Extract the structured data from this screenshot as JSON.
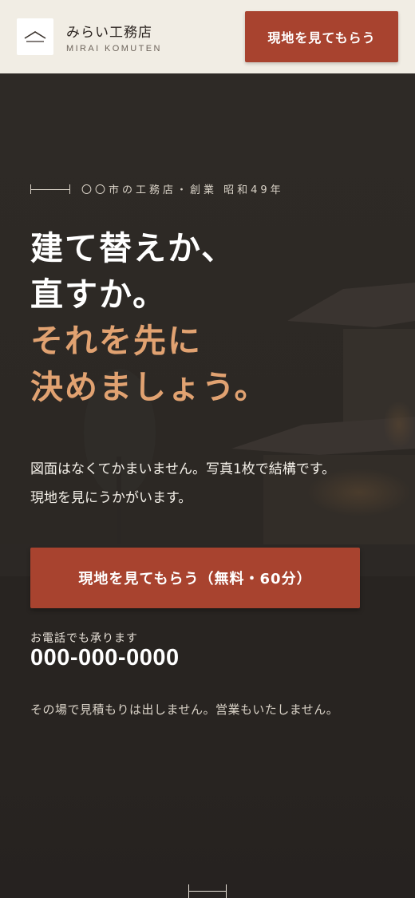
{
  "header": {
    "brand_name": "みらい工務店",
    "brand_sub": "MIRAI KOMUTEN",
    "logo_icon": "house-roof-icon",
    "cta_label": "現地を見てもらう"
  },
  "hero": {
    "eyebrow": "〇〇市の工務店・創業 昭和49年",
    "headline_lines": [
      "建て替えか、",
      "直すか。"
    ],
    "accent_lines": [
      "それを先に",
      "決めましょう。"
    ],
    "lead_lines": [
      "図面はなくてかまいません。写真1枚で結構です。",
      "現地を見にうかがいます。"
    ],
    "cta_label": "現地を見てもらう（無料・60分）",
    "phone_label": "お電話でも承ります",
    "phone_number": "000-000-0000",
    "note": "その場で見積もりは出しません。営業もいたしません。"
  },
  "colors": {
    "header_bg": "#f1ede4",
    "accent_button": "#a8432f",
    "headline_accent": "#e1a271",
    "hero_bg": "#2b2622"
  }
}
